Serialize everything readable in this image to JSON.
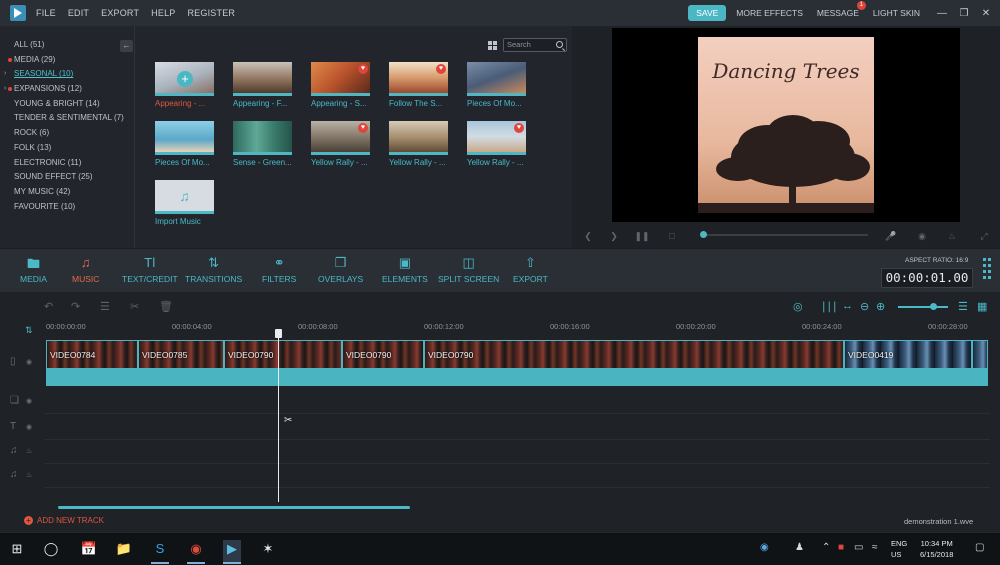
{
  "menu": [
    "FILE",
    "EDIT",
    "EXPORT",
    "HELP",
    "REGISTER"
  ],
  "right_menu": {
    "save": "SAVE",
    "more_effects": "MORE EFFECTS",
    "message": "MESSAGE",
    "message_count": "1",
    "light_skin": "LIGHT SKIN"
  },
  "categories": [
    {
      "label": "ALL (51)"
    },
    {
      "label": "MEDIA (29)"
    },
    {
      "label": "SEASONAL (10)"
    },
    {
      "label": "EXPANSIONS (12)"
    },
    {
      "label": "YOUNG & BRIGHT (14)"
    },
    {
      "label": "TENDER & SENTIMENTAL (7)"
    },
    {
      "label": "ROCK (6)"
    },
    {
      "label": "FOLK (13)"
    },
    {
      "label": "ELECTRONIC (11)"
    },
    {
      "label": "SOUND EFFECT (25)"
    },
    {
      "label": "MY MUSIC (42)"
    },
    {
      "label": "FAVOURITE (10)"
    }
  ],
  "search": {
    "placeholder": "Search"
  },
  "library_items": [
    {
      "label": "Appearing - ..."
    },
    {
      "label": "Appearing - F..."
    },
    {
      "label": "Appearing - S..."
    },
    {
      "label": "Follow The S..."
    },
    {
      "label": "Pieces Of Mo..."
    },
    {
      "label": "Pieces Of Mo..."
    },
    {
      "label": "Sense - Green..."
    },
    {
      "label": "Yellow Rally - ..."
    },
    {
      "label": "Yellow Rally - ..."
    },
    {
      "label": "Yellow Rally - ..."
    },
    {
      "label": "Import Music"
    }
  ],
  "preview": {
    "album_title": "Dancing Trees"
  },
  "toolbar": {
    "tools": [
      {
        "label": "MEDIA"
      },
      {
        "label": "MUSIC"
      },
      {
        "label": "TEXT/CREDIT"
      },
      {
        "label": "TRANSITIONS"
      },
      {
        "label": "FILTERS"
      },
      {
        "label": "OVERLAYS"
      },
      {
        "label": "ELEMENTS"
      },
      {
        "label": "SPLIT SCREEN"
      },
      {
        "label": "EXPORT"
      }
    ],
    "aspect_ratio": "ASPECT RATIO: 16:9",
    "timecode": "00:00:01.00"
  },
  "ruler": [
    "00:00:00:00",
    "00:00:04:00",
    "00:00:08:00",
    "00:00:12:00",
    "00:00:16:00",
    "00:00:20:00",
    "00:00:24:00",
    "00:00:28:00"
  ],
  "clips": [
    {
      "name": "VIDEO0784"
    },
    {
      "name": "VIDEO0785"
    },
    {
      "name": "VIDEO0790"
    },
    {
      "name": "VIDEO0790"
    },
    {
      "name": "VIDEO0790"
    },
    {
      "name": "VIDEO0419"
    },
    {
      "name": ""
    }
  ],
  "footer": {
    "add_track": "ADD NEW TRACK",
    "project_name": "demonstration 1.wve"
  },
  "taskbar": {
    "lang": "ENG",
    "region": "US",
    "time": "10:34 PM",
    "date": "6/15/2018"
  }
}
